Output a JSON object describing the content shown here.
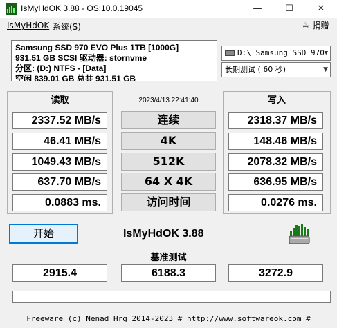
{
  "window": {
    "title": "IsMyHdOK 3.88 - OS:10.0.19045",
    "minimize": "—",
    "maximize": "☐",
    "close": "✕"
  },
  "menu": {
    "file": "IsMyHdOK",
    "system": "系统(S)",
    "donate": "捐赠"
  },
  "info": {
    "line1": "Samsung SSD 970 EVO Plus 1TB [1000G]",
    "line2": "931.51 GB  SCSI 驱动器: stornvme",
    "line3": "分区: (D:) NTFS - [Data]",
    "line4": "空闲 839.01 GB 总共 931.51 GB"
  },
  "drive_select": "D:\\ Samsung SSD 970",
  "mode_select": "长期测试 ( 60 秒)",
  "read_header": "读取",
  "write_header": "写入",
  "timestamp": "2023/4/13 22:41:40",
  "rows": [
    {
      "read": "2337.52 MB/s",
      "label": "连续",
      "write": "2318.37 MB/s"
    },
    {
      "read": "46.41 MB/s",
      "label": "4K",
      "write": "148.46 MB/s"
    },
    {
      "read": "1049.43 MB/s",
      "label": "512K",
      "write": "2078.32 MB/s"
    },
    {
      "read": "637.70 MB/s",
      "label": "64 X 4K",
      "write": "636.95 MB/s"
    },
    {
      "read": "0.0883 ms.",
      "label": "访问时间",
      "write": "0.0276 ms."
    }
  ],
  "start_button": "开始",
  "app_name": "IsMyHdOK 3.88",
  "bench_label": "基准测试",
  "bench": {
    "read": "2915.4",
    "total": "6188.3",
    "write": "3272.9"
  },
  "progress": 0,
  "footer": "Freeware (c) Nenad Hrg 2014-2023 # http://www.softwareok.com   #"
}
